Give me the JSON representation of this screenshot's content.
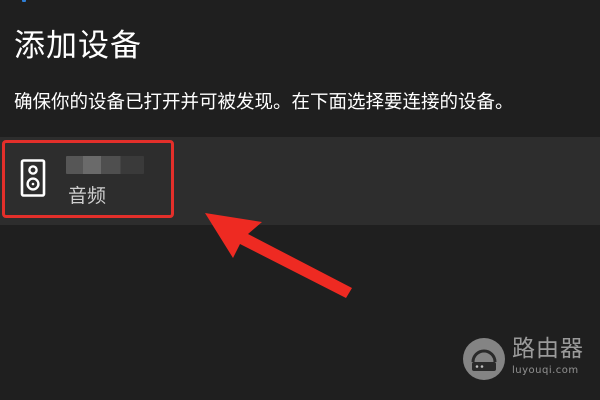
{
  "dialog": {
    "title": "添加设备",
    "instruction": "确保你的设备已打开并可被发现。在下面选择要连接的设备。"
  },
  "devices": [
    {
      "name": "",
      "type": "音频",
      "icon": "speaker-icon",
      "name_redacted": true,
      "highlighted": true
    }
  ],
  "watermark": {
    "text": "路由器",
    "url": "luyouqi.com"
  },
  "colors": {
    "background": "#1f1f1f",
    "device_band": "#2d2d2d",
    "highlight": "#e32f2a",
    "accent": "#2f7fd6",
    "text_primary": "#ffffff",
    "text_secondary": "#cfcfcf"
  }
}
